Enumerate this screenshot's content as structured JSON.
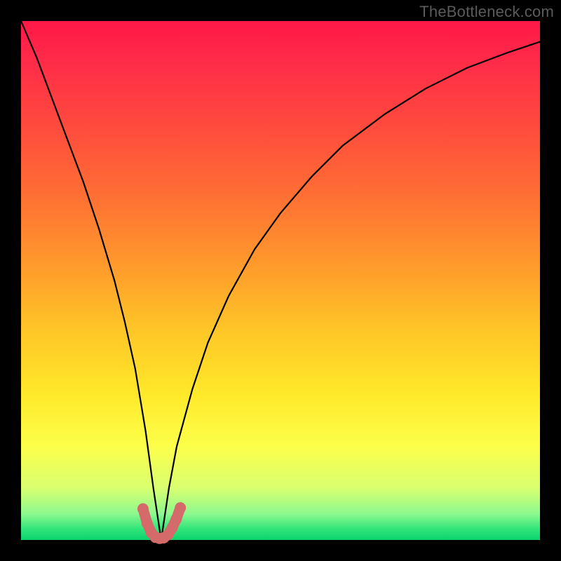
{
  "watermark": "TheBottleneck.com",
  "colors": {
    "page_bg": "#000000",
    "gradient_top": "#ff1848",
    "gradient_mid1": "#ff6d34",
    "gradient_mid2": "#ffe92a",
    "gradient_bottom": "#0ad36d",
    "curve_stroke": "#000000",
    "marker_stroke": "#d56a6a",
    "marker_fill": "#d56a6a"
  },
  "chart_data": {
    "type": "line",
    "title": "",
    "xlabel": "",
    "ylabel": "",
    "xlim": [
      0,
      100
    ],
    "ylim": [
      0,
      100
    ],
    "grid": false,
    "legend": false,
    "notes": "No axis ticks or numeric labels are rendered. Values below are read off pixel positions, normalized to 0–100. The black curve is a single V-shaped line with a sharp minimum near x≈27 (y≈0). A short pink/red U-shaped marker segment sits at the trough.",
    "series": [
      {
        "name": "black-curve",
        "color": "#000000",
        "x": [
          0,
          3,
          6,
          9,
          12,
          15,
          18,
          20,
          22,
          24,
          25.5,
          27,
          28.5,
          30,
          33,
          36,
          40,
          45,
          50,
          56,
          62,
          70,
          78,
          86,
          94,
          100
        ],
        "y": [
          100,
          93,
          85,
          77,
          69,
          60,
          50,
          42,
          33,
          21,
          10,
          0,
          10,
          18,
          29,
          38,
          47,
          56,
          63,
          70,
          76,
          82,
          87,
          91,
          94,
          96
        ]
      },
      {
        "name": "trough-marker",
        "color": "#d56a6a",
        "x": [
          23.5,
          24.3,
          25.1,
          25.9,
          26.7,
          27.5,
          28.3,
          29.1,
          29.9,
          30.7
        ],
        "y": [
          6.0,
          3.2,
          1.4,
          0.5,
          0.3,
          0.4,
          1.0,
          2.3,
          4.0,
          6.2
        ]
      }
    ]
  }
}
